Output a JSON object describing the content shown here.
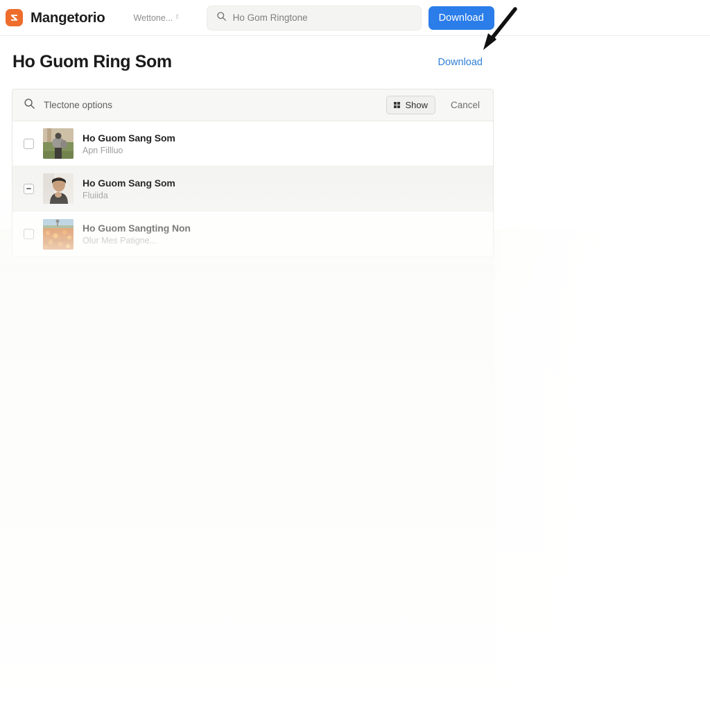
{
  "header": {
    "brand_name": "Mangetorio",
    "brand_logo_icon": "z-logo-icon",
    "nav_item_label": "Wettone...",
    "nav_item_icon": "small-glyph-icon",
    "search": {
      "icon": "search-icon",
      "value": "Ho Gom Ringtone"
    },
    "download_button_label": "Download"
  },
  "annotation": {
    "arrow_icon": "arrow-pointing-down-left-icon"
  },
  "title_row": {
    "page_title": "Ho Guom Ring Som",
    "download_link_label": "Download"
  },
  "options_bar": {
    "search_icon": "search-icon",
    "label": "Tlectone options",
    "show_button_label": "Show",
    "show_button_icon": "grid-icon",
    "cancel_button_label": "Cancel"
  },
  "list": {
    "rows": [
      {
        "checkbox_state": "unchecked",
        "thumbnail": "person-on-grass-photo",
        "title": "Ho Guom Sang Som",
        "subtitle": "Apn Fillluo"
      },
      {
        "checkbox_state": "indeterminate",
        "thumbnail": "person-portrait-photo",
        "title": "Ho Guom Sang Som",
        "subtitle": "Fluiida"
      },
      {
        "checkbox_state": "unchecked",
        "thumbnail": "orange-flower-field-photo",
        "title": "Ho Guom Sangting Non",
        "subtitle": "Olur Mes Patigne..."
      }
    ]
  },
  "colors": {
    "brand_orange": "#ee6c2c",
    "primary_blue": "#2b7de9",
    "link_blue": "#2f7fd4",
    "page_background": "#ffffff",
    "options_bar_background": "#f7f7f5",
    "row_alt_background": "#f4f4f2"
  }
}
